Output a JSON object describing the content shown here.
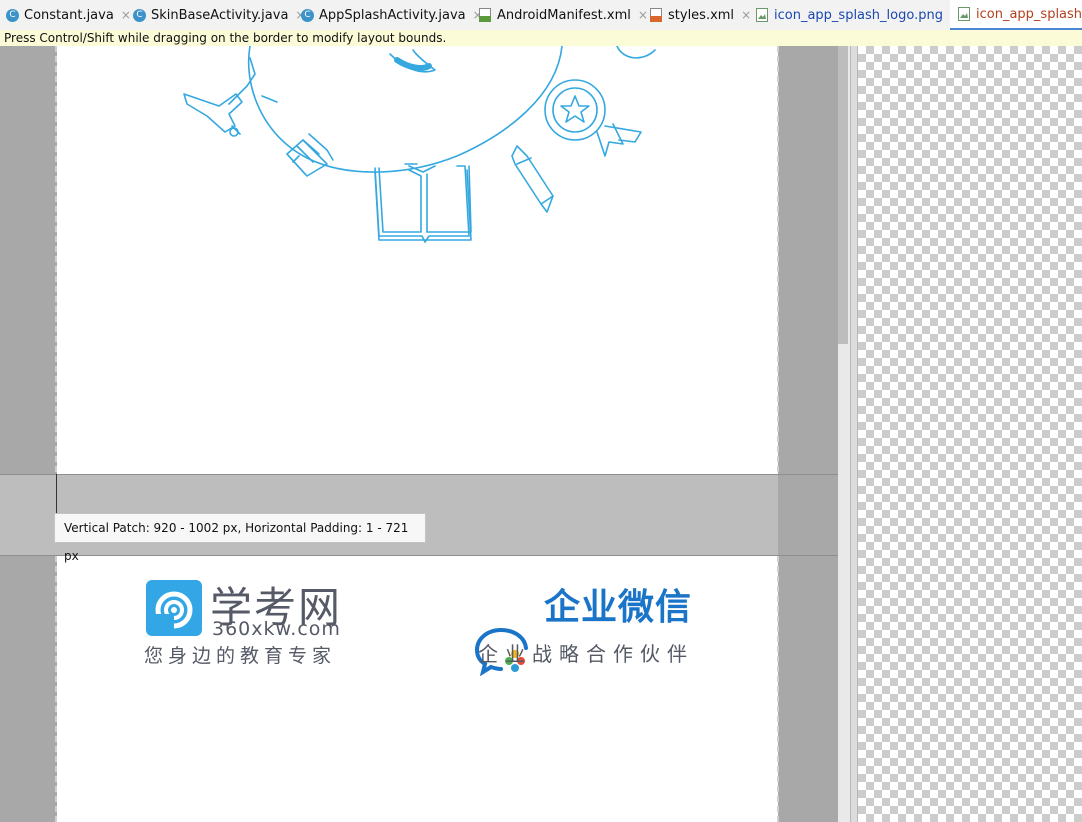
{
  "tabs": [
    {
      "label": "Constant.java",
      "icon": "java-class-icon"
    },
    {
      "label": "SkinBaseActivity.java",
      "icon": "java-class-icon"
    },
    {
      "label": "AppSplashActivity.java",
      "icon": "java-class-icon"
    },
    {
      "label": "AndroidManifest.xml",
      "icon": "manifest-file-icon"
    },
    {
      "label": "styles.xml",
      "icon": "xml-file-icon"
    },
    {
      "label": "icon_app_splash_logo.png",
      "icon": "image-file-icon"
    },
    {
      "label": "icon_app_splash_lo",
      "icon": "image-file-icon"
    }
  ],
  "close_glyph": "×",
  "class_glyph": "C",
  "hint": "Press Control/Shift while dragging on the border to modify layout bounds.",
  "tooltip": "Vertical Patch: 920 - 1002 px, Horizontal Padding: 1 - 721 px",
  "logos": {
    "xkw": {
      "title": "学考网",
      "domain": "360xkw.com",
      "slogan": "您身边的教育专家"
    },
    "wework": {
      "title": "企业微信",
      "slogan": "企业战略合作伙伴"
    }
  },
  "colors": {
    "illustration": "#35a8e0",
    "xkw_brand": "#33a7e6",
    "wework_brand": "#1a74c8",
    "active_tab": "#b3411d"
  }
}
